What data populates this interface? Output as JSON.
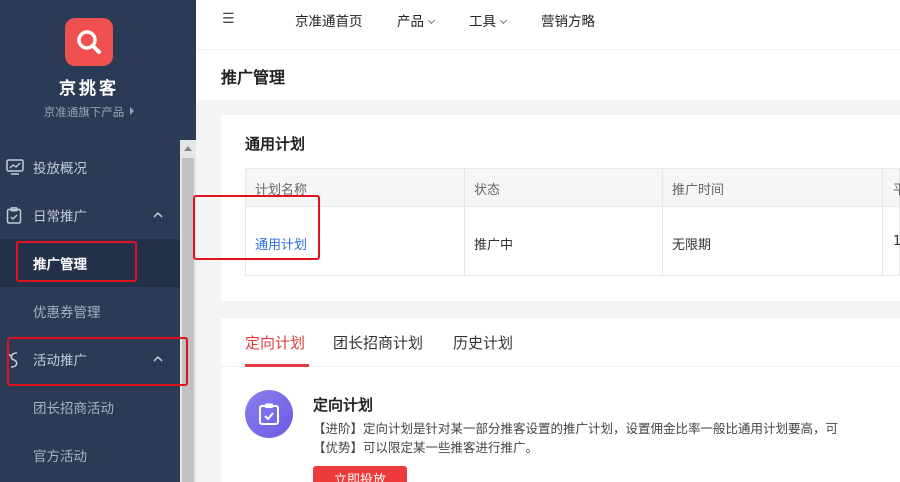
{
  "sidebar": {
    "brand": "京挑客",
    "brand_sub": "京准通旗下产品",
    "items": [
      {
        "label": "投放概况"
      },
      {
        "label": "日常推广"
      },
      {
        "label": "推广管理"
      },
      {
        "label": "优惠券管理"
      },
      {
        "label": "活动推广"
      },
      {
        "label": "团长招商活动"
      },
      {
        "label": "官方活动"
      }
    ]
  },
  "topnav": {
    "toggle": "☰",
    "links": [
      {
        "label": "京准通首页"
      },
      {
        "label": "产品"
      },
      {
        "label": "工具"
      },
      {
        "label": "营销方略"
      }
    ]
  },
  "page": {
    "title": "推广管理"
  },
  "general_plan": {
    "title": "通用计划",
    "columns": [
      "计划名称",
      "状态",
      "推广时间",
      "平"
    ],
    "row": {
      "name": "通用计划",
      "status": "推广中",
      "time": "无限期",
      "extra": "1"
    }
  },
  "targeted": {
    "tabs": [
      "定向计划",
      "团长招商计划",
      "历史计划"
    ],
    "title": "定向计划",
    "desc1": "【进阶】定向计划是针对某一部分推客设置的推广计划，设置佣金比率一般比通用计划要高，可",
    "desc2": "【优势】可以限定某一些推客进行推广。",
    "button": "立即投放"
  },
  "colors": {
    "sidebar": "#2b3a55",
    "accent": "#e23c3c",
    "link": "#2a6fdb"
  }
}
